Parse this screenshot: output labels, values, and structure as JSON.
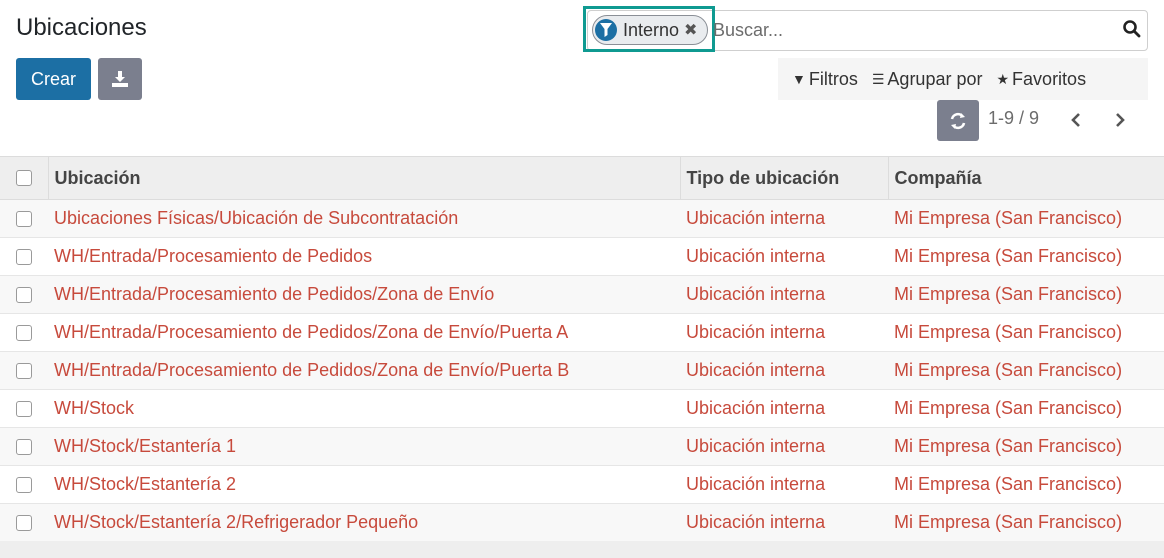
{
  "page": {
    "title": "Ubicaciones"
  },
  "toolbar": {
    "create_label": "Crear",
    "download_icon": "download-icon"
  },
  "search": {
    "facet_label": "Interno",
    "facet_icon": "filter-icon",
    "placeholder": "Buscar..."
  },
  "filters": {
    "filters_label": "Filtros",
    "group_by_label": "Agrupar por",
    "favorites_label": "Favoritos"
  },
  "pager": {
    "range": "1-9 / 9"
  },
  "colors": {
    "primary": "#1c6fa4",
    "secondary": "#7b7f8e",
    "link": "#c74a3c",
    "highlight": "#0f9a91"
  },
  "table": {
    "headers": [
      "Ubicación",
      "Tipo de ubicación",
      "Compañía"
    ],
    "rows": [
      [
        "Ubicaciones Físicas/Ubicación de Subcontratación",
        "Ubicación interna",
        "Mi Empresa (San Francisco)"
      ],
      [
        "WH/Entrada/Procesamiento de Pedidos",
        "Ubicación interna",
        "Mi Empresa (San Francisco)"
      ],
      [
        "WH/Entrada/Procesamiento de Pedidos/Zona de Envío",
        "Ubicación interna",
        "Mi Empresa (San Francisco)"
      ],
      [
        "WH/Entrada/Procesamiento de Pedidos/Zona de Envío/Puerta A",
        "Ubicación interna",
        "Mi Empresa (San Francisco)"
      ],
      [
        "WH/Entrada/Procesamiento de Pedidos/Zona de Envío/Puerta B",
        "Ubicación interna",
        "Mi Empresa (San Francisco)"
      ],
      [
        "WH/Stock",
        "Ubicación interna",
        "Mi Empresa (San Francisco)"
      ],
      [
        "WH/Stock/Estantería 1",
        "Ubicación interna",
        "Mi Empresa (San Francisco)"
      ],
      [
        "WH/Stock/Estantería 2",
        "Ubicación interna",
        "Mi Empresa (San Francisco)"
      ],
      [
        "WH/Stock/Estantería 2/Refrigerador Pequeño",
        "Ubicación interna",
        "Mi Empresa (San Francisco)"
      ]
    ]
  }
}
